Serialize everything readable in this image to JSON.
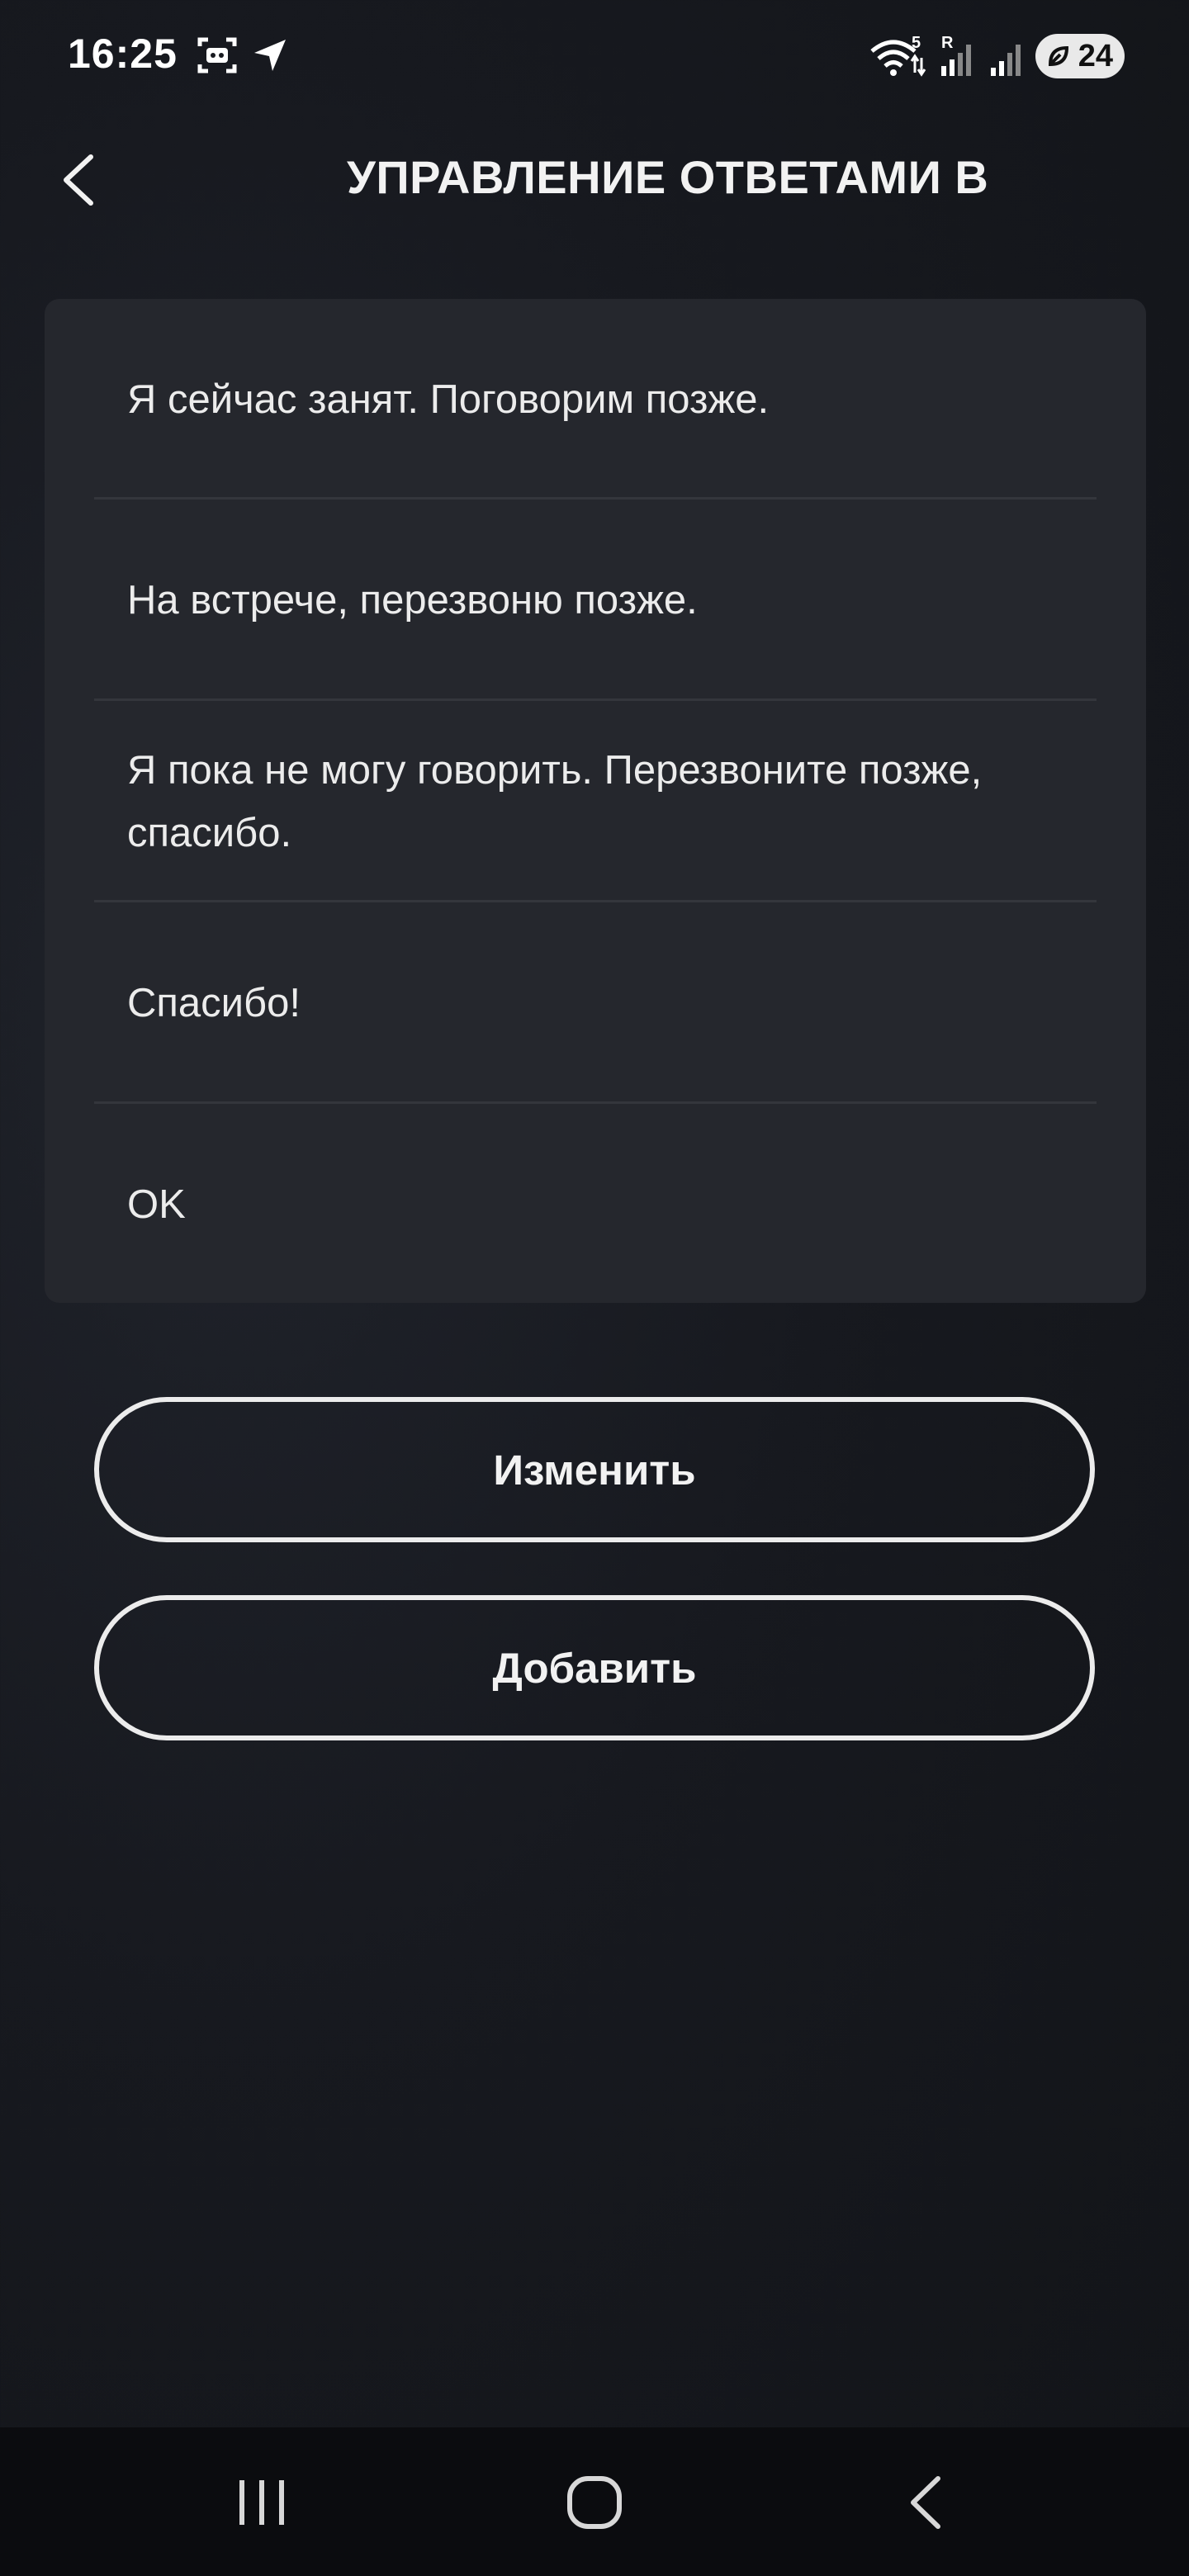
{
  "status_bar": {
    "time": "16:25",
    "network_label": "5",
    "roaming_label": "R",
    "battery_level": "24",
    "icons": [
      "screen-record-icon",
      "navigation-arrow-icon",
      "wifi-icon",
      "signal-icon",
      "signal-icon",
      "battery-saver-icon"
    ]
  },
  "header": {
    "title": "УПРАВЛЕНИЕ ОТВЕТАМИ В",
    "back_icon": "chevron-left-icon"
  },
  "replies": [
    {
      "text": "Я сейчас занят. Поговорим позже."
    },
    {
      "text": "На встрече, перезвоню позже."
    },
    {
      "text": "Я пока не могу говорить. Перезвоните позже, спасибо."
    },
    {
      "text": "Спасибо!"
    },
    {
      "text": "OK"
    }
  ],
  "actions": {
    "edit_label": "Изменить",
    "add_label": "Добавить"
  },
  "nav_bar": {
    "icons": [
      "recent-apps-icon",
      "home-icon",
      "back-icon"
    ]
  },
  "colors": {
    "background": "#17191f",
    "card": "#25272d",
    "divider": "#34363c",
    "text": "#ececec"
  }
}
